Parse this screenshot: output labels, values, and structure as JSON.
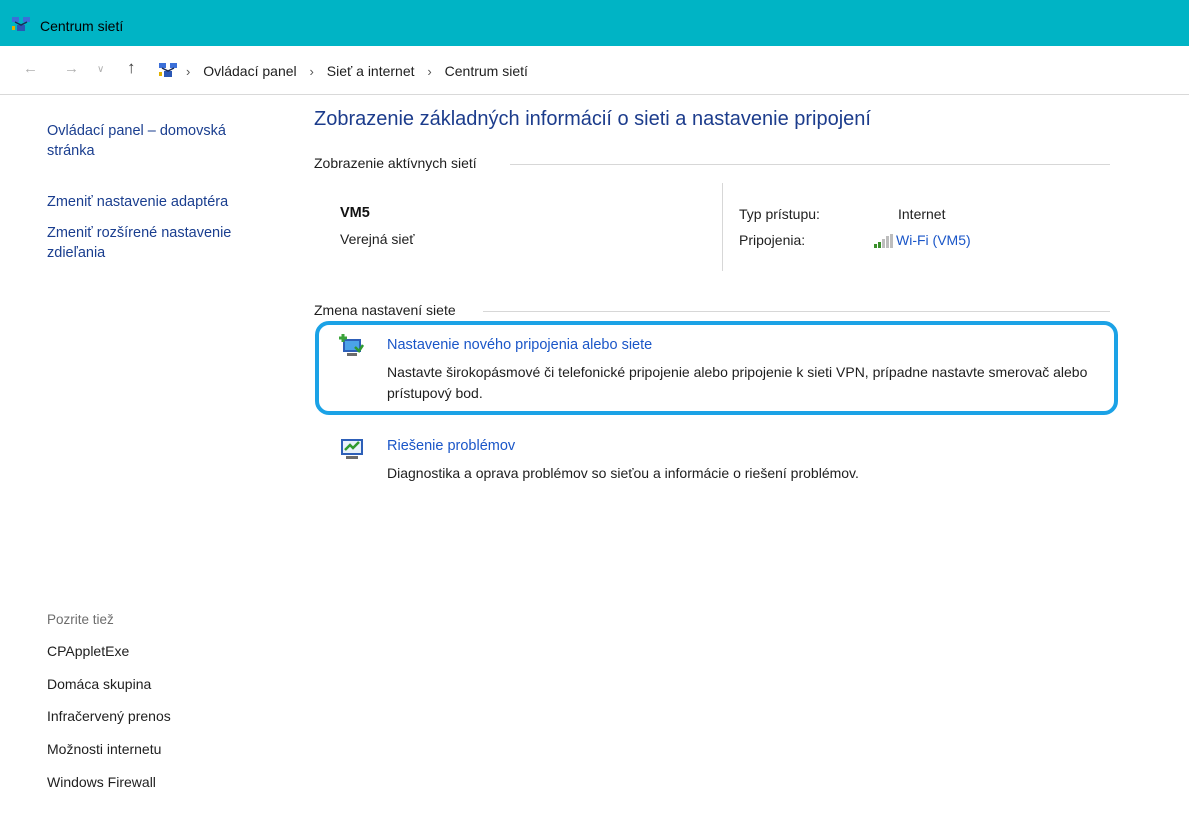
{
  "window": {
    "title": "Centrum sietí",
    "accent": "#00b4c5"
  },
  "addressbar": {
    "nav_icons": [
      "back-arrow-icon",
      "forward-arrow-icon",
      "chevron-down-icon",
      "up-arrow-icon"
    ],
    "breadcrumb": [
      "Ovládací panel",
      "Sieť a internet",
      "Centrum sietí"
    ]
  },
  "sidebar": {
    "items": [
      {
        "label": "Ovládací panel – domovská stránka"
      },
      {
        "label": "Zmeniť nastavenie adaptéra"
      },
      {
        "label": "Zmeniť rozšírené nastavenie zdieľania"
      }
    ],
    "see_also_heading": "Pozrite tiež",
    "see_also": [
      "CPAppletExe",
      "Domáca skupina",
      "Infračervený prenos",
      "Možnosti internetu",
      "Windows Firewall"
    ]
  },
  "main": {
    "title": "Zobrazenie základných informácií o sieti a nastavenie pripojení",
    "active_networks_heading": "Zobrazenie aktívnych sietí",
    "network": {
      "name": "VM5",
      "category": "Verejná sieť",
      "access_type_label": "Typ prístupu:",
      "access_type_value": "Internet",
      "connections_label": "Pripojenia:",
      "connection_link": "Wi-Fi (VM5)"
    },
    "change_heading": "Zmena nastavení siete",
    "tasks": [
      {
        "icon": "new-connection-icon",
        "title": "Nastavenie nového pripojenia alebo siete",
        "description": "Nastavte širokopásmové či telefonické pripojenie alebo pripojenie k sieti VPN, prípadne nastavte smerovač alebo prístupový bod.",
        "highlighted": true,
        "highlight_color": "#1ba2e6"
      },
      {
        "icon": "troubleshoot-icon",
        "title": "Riešenie problémov",
        "description": "Diagnostika a oprava problémov so sieťou a informácie o riešení problémov."
      }
    ]
  }
}
